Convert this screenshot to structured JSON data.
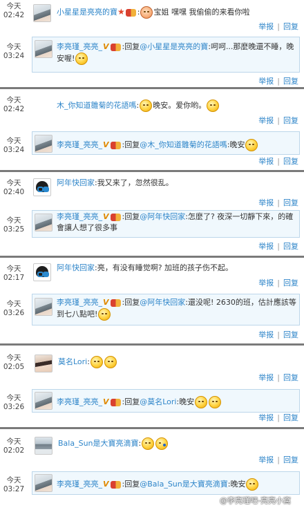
{
  "entries": [
    {
      "top_time": [
        "今天",
        "02:42"
      ],
      "top_user": "小星星是亮亮的寶",
      "top_text_before": ":",
      "top_text": "宝姐 嘿嘿 我偷偷的来看你啦",
      "reply_time": [
        "今天",
        "03:24"
      ],
      "reply_user": "李亮瑾_亮亮_",
      "reply_v": "V",
      "reply_prefix": ":回复",
      "reply_mention": "@小星星是亮亮的寶",
      "reply_text": ":呵呵...那麼晚還不睡，晚安喔!"
    },
    {
      "top_time": [
        "今天",
        "02:42"
      ],
      "top_user": "木_你知道雛菊的花語嗎",
      "top_text_before": ":",
      "top_text": "晚安。爱你哟。",
      "reply_time": [
        "今天",
        "03:24"
      ],
      "reply_user": "李亮瑾_亮亮_",
      "reply_v": "V",
      "reply_prefix": ":回复",
      "reply_mention": "@木_你知道雛菊的花語嗎",
      "reply_text": ":晚安"
    },
    {
      "top_time": [
        "今天",
        "02:40"
      ],
      "top_user": "阿年快回家",
      "top_text_before": ":",
      "top_text": "我又来了，忽然很乱。",
      "reply_time": [
        "今天",
        "03:25"
      ],
      "reply_user": "李亮瑾_亮亮_",
      "reply_v": "V",
      "reply_prefix": ":回复",
      "reply_mention": "@阿年快回家",
      "reply_text": ":怎麼了? 夜深一切靜下來，的確會讓人想了很多事"
    },
    {
      "top_time": [
        "今天",
        "02:17"
      ],
      "top_user": "阿年快回家",
      "top_text_before": ":",
      "top_text": "亮，有没有睡觉啊? 加班的孩子伤不起。",
      "reply_time": [
        "今天",
        "03:26"
      ],
      "reply_user": "李亮瑾_亮亮_",
      "reply_v": "V",
      "reply_prefix": ":回复",
      "reply_mention": "@阿年快回家",
      "reply_text": ":還没呢! 2630的班，估計應該等到七八點吧!"
    },
    {
      "top_time": [
        "今天",
        "02:05"
      ],
      "top_user": "莫名Lori",
      "top_text_before": ":",
      "top_text": "",
      "reply_time": [
        "今天",
        "03:26"
      ],
      "reply_user": "李亮瑾_亮亮_",
      "reply_v": "V",
      "reply_prefix": ":回复",
      "reply_mention": "@莫名Lori",
      "reply_text": ":晚安"
    },
    {
      "top_time": [
        "今天",
        "02:02"
      ],
      "top_user": "Bala_Sun是大寶亮滴寶",
      "top_text_before": ":",
      "top_text": "",
      "reply_time": [
        "今天",
        "03:27"
      ],
      "reply_user": "李亮瑾_亮亮_",
      "reply_v": "V",
      "reply_prefix": ":回复",
      "reply_mention": "@Bala_Sun是大寶亮滴寶",
      "reply_text": ":晚安"
    }
  ],
  "actions": {
    "report": "举报",
    "reply": "回复",
    "divider": "|"
  },
  "watermark": "@李亮瑾吧-亮亮小窩",
  "icons": {
    "star": "star-icon",
    "badge": "member-badge-icon",
    "emoji": "emoji-icon"
  },
  "colors": {
    "link": "#2e85c9",
    "bubble_bg": "#f0f8fd",
    "bubble_border": "#bcd6ea",
    "separator": "#7a7a7a"
  }
}
